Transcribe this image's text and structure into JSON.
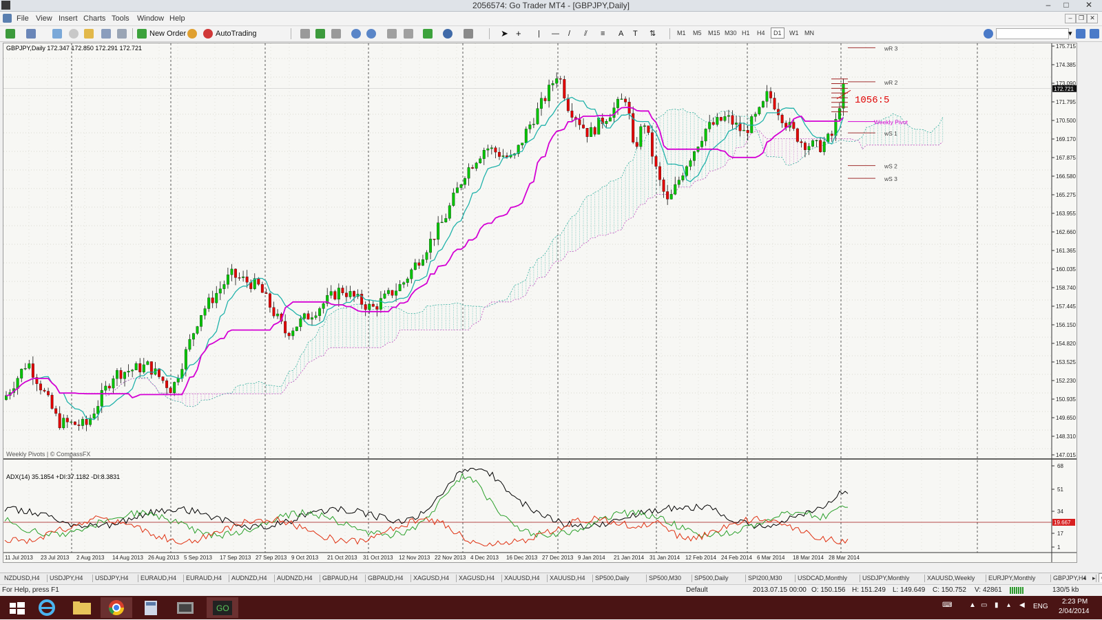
{
  "window": {
    "title": "2056574: Go Trader MT4 - [GBPJPY,Daily]"
  },
  "menu": [
    "File",
    "View",
    "Insert",
    "Charts",
    "Tools",
    "Window",
    "Help"
  ],
  "toolbar": {
    "new_order": "New Order",
    "autotrading": "AutoTrading",
    "timeframes": [
      "M1",
      "M5",
      "M15",
      "M30",
      "H1",
      "H4",
      "D1",
      "W1",
      "MN"
    ],
    "active_timeframe": "D1"
  },
  "chart": {
    "header": "GBPJPY,Daily  172.347 172.850 172.291 172.721",
    "watermark": "Weekly Pivots | © CompassFX",
    "price_labels": [
      "175.715",
      "174.385",
      "173.090",
      "171.795",
      "170.500",
      "169.170",
      "167.875",
      "166.580",
      "165.275",
      "163.955",
      "162.660",
      "161.365",
      "160.035",
      "158.740",
      "157.445",
      "156.150",
      "154.820",
      "153.525",
      "152.230",
      "150.935",
      "149.650",
      "148.310",
      "147.015"
    ],
    "current_price": "172.721",
    "annotation": "1056:5",
    "pivot_labels": [
      "wR 3",
      "wR 2",
      "Weekly Pivot",
      "wS 1",
      "wS 2",
      "wS 3"
    ],
    "date_labels": [
      "11 Jul 2013",
      "23 Jul 2013",
      "2 Aug 2013",
      "14 Aug 2013",
      "26 Aug 2013",
      "5 Sep 2013",
      "17 Sep 2013",
      "27 Sep 2013",
      "9 Oct 2013",
      "21 Oct 2013",
      "31 Oct 2013",
      "12 Nov 2013",
      "22 Nov 2013",
      "4 Dec 2013",
      "16 Dec 2013",
      "27 Dec 2013",
      "9 Jan 2014",
      "21 Jan 2014",
      "31 Jan 2014",
      "12 Feb 2014",
      "24 Feb 2014",
      "6 Mar 2014",
      "18 Mar 2014",
      "28 Mar 2014"
    ]
  },
  "adx": {
    "header": "ADX(14) 35.1854 +DI:37.1182 -DI:8.3831",
    "scale": [
      "68",
      "51",
      "34",
      "17",
      "1"
    ],
    "level_label": "19.667"
  },
  "tabs": [
    "NZDUSD,H4",
    "USDJPY,H4",
    "USDJPY,H4",
    "EURAUD,H4",
    "EURAUD,H4",
    "AUDNZD,H4",
    "AUDNZD,H4",
    "GBPAUD,H4",
    "GBPAUD,H4",
    "XAGUSD,H4",
    "XAGUSD,H4",
    "XAUUSD,H4",
    "XAUUSD,H4",
    "SP500,Daily",
    "SP500,M30",
    "SP500,Daily",
    "SPI200,M30",
    "USDCAD,Monthly",
    "USDJPY,Monthly",
    "XAUUSD,Weekly",
    "EURJPY,Monthly",
    "GBPJPY,H4",
    "GBPJPY,"
  ],
  "status": {
    "help": "For Help, press F1",
    "profile": "Default",
    "time": "2013.07.15 00:00",
    "open": "O: 150.156",
    "high": "H: 151.249",
    "low": "L: 149.649",
    "close": "C: 150.752",
    "volume": "V: 42861",
    "traffic": "130/5 kb"
  },
  "taskbar": {
    "lang": "ENG",
    "time": "2:23 PM",
    "date": "2/04/2014"
  },
  "colors": {
    "bull": "#00c400",
    "bear": "#e00000",
    "kijun": "#d400d4",
    "tenkan": "#20b2aa",
    "cloud_up": "#38b0a0",
    "cloud_dn": "#c050c0",
    "adx": "#000000",
    "plus_di": "#2aa02a",
    "minus_di": "#e03010"
  }
}
